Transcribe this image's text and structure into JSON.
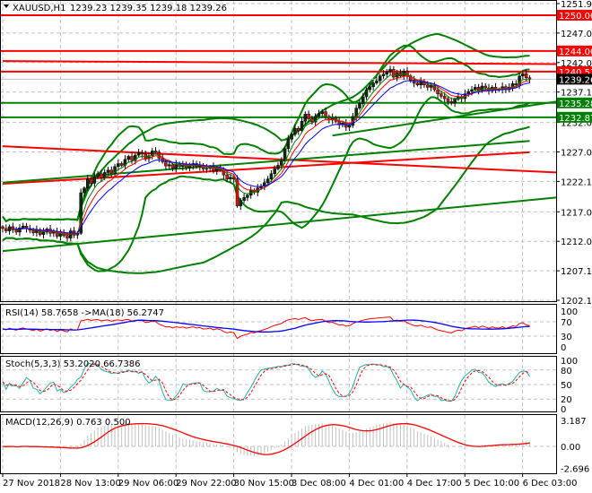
{
  "header": {
    "symbol": "XAUUSD,H1",
    "ohlc": "1239.23 1239.35 1239.18 1239.26"
  },
  "chart_data": [
    {
      "type": "candlestick",
      "panel": "main",
      "symbol": "XAUUSD",
      "timeframe": "H1",
      "ylim": [
        1202.15,
        1251.95
      ],
      "y_ticks": [
        "1251.95",
        "1247.00",
        "1242.05",
        "1237.10",
        "1232.00",
        "1227.05",
        "1222.10",
        "1217.00",
        "1212.05",
        "1207.10",
        "1202.15"
      ],
      "x_ticks": [
        "27 Nov 2018",
        "28 Nov 13:00",
        "29 Nov 06:00",
        "29 Nov 22:00",
        "30 Nov 15:00",
        "3 Dec 08:00",
        "4 Dec 01:00",
        "4 Dec 17:00",
        "5 Dec 10:00",
        "6 Dec 03:00"
      ],
      "grid": true,
      "current_price": "1239.26",
      "closes": [
        1214.2,
        1213.8,
        1214.5,
        1214.0,
        1213.6,
        1214.3,
        1214.6,
        1214.2,
        1213.9,
        1213.5,
        1214.0,
        1213.2,
        1213.6,
        1214.1,
        1213.4,
        1213.7,
        1212.9,
        1213.5,
        1213.0,
        1212.6,
        1213.8,
        1213.1,
        1213.4,
        1220.2,
        1221.0,
        1222.5,
        1221.8,
        1222.9,
        1223.4,
        1222.7,
        1223.6,
        1224.0,
        1223.4,
        1224.6,
        1225.1,
        1224.8,
        1225.8,
        1226.3,
        1225.6,
        1226.5,
        1226.9,
        1226.7,
        1225.9,
        1226.4,
        1227.2,
        1227.0,
        1226.0,
        1225.4,
        1224.7,
        1224.9,
        1224.3,
        1225.0,
        1224.6,
        1224.9,
        1224.4,
        1224.7,
        1225.1,
        1224.6,
        1224.8,
        1224.2,
        1224.3,
        1224.6,
        1223.9,
        1224.3,
        1224.0,
        1223.2,
        1222.5,
        1222.8,
        1222.5,
        1218.0,
        1218.9,
        1219.4,
        1219.8,
        1220.6,
        1220.3,
        1221.0,
        1221.3,
        1221.9,
        1222.5,
        1223.4,
        1224.2,
        1224.8,
        1225.5,
        1227.6,
        1229.2,
        1230.0,
        1231.0,
        1230.6,
        1232.2,
        1233.4,
        1232.6,
        1232.1,
        1233.0,
        1233.5,
        1233.8,
        1233.0,
        1232.4,
        1232.8,
        1232.2,
        1231.6,
        1231.9,
        1231.2,
        1231.5,
        1233.0,
        1234.4,
        1235.2,
        1236.3,
        1237.5,
        1238.0,
        1238.6,
        1239.0,
        1239.8,
        1240.1,
        1240.5,
        1240.9,
        1239.6,
        1240.3,
        1239.8,
        1240.6,
        1239.8,
        1239.1,
        1238.6,
        1238.3,
        1238.9,
        1238.3,
        1237.9,
        1238.2,
        1237.5,
        1236.8,
        1236.4,
        1236.0,
        1235.5,
        1235.3,
        1235.9,
        1236.3,
        1236.0,
        1236.8,
        1237.2,
        1237.5,
        1237.9,
        1237.4,
        1238.1,
        1237.8,
        1237.3,
        1237.9,
        1237.6,
        1237.5,
        1238.0,
        1237.5,
        1237.9,
        1238.5,
        1238.3,
        1239.8,
        1240.2,
        1239.5,
        1239.26
      ],
      "levels": [
        {
          "price": "1250.00",
          "color": "#ff0000"
        },
        {
          "price": "1244.00",
          "color": "#ff0000"
        },
        {
          "price": "1240.53",
          "color": "#ff0000"
        },
        {
          "price": "1235.28",
          "color": "#008000"
        },
        {
          "price": "1232.87",
          "color": "#008000"
        }
      ],
      "trendlines": [
        {
          "color": "#ff0000",
          "from": {
            "bar": 0,
            "price": 1242.3
          },
          "to": {
            "bar": 163,
            "price": 1241.8
          }
        },
        {
          "color": "#ff0000",
          "from": {
            "bar": 0,
            "price": 1228.0
          },
          "to": {
            "bar": 163,
            "price": 1223.6
          }
        },
        {
          "color": "#ff0000",
          "from": {
            "bar": 0,
            "price": 1221.7
          },
          "to": {
            "bar": 155,
            "price": 1227.0
          }
        },
        {
          "color": "#008000",
          "from": {
            "bar": 0,
            "price": 1221.9
          },
          "to": {
            "bar": 155,
            "price": 1228.9
          }
        },
        {
          "color": "#008000",
          "from": {
            "bar": 0,
            "price": 1210.4
          },
          "to": {
            "bar": 163,
            "price": 1219.4
          }
        },
        {
          "color": "#008000",
          "from": {
            "bar": 97,
            "price": 1229.8
          },
          "to": {
            "bar": 163,
            "price": 1235.5
          }
        }
      ],
      "moving_averages": [
        {
          "period": 5,
          "color": "#008000"
        },
        {
          "period": 8,
          "color": "#ff0000"
        },
        {
          "period": 13,
          "color": "#0000ff"
        }
      ],
      "bollinger": [
        {
          "period": 20,
          "deviation": 2,
          "color": "#008000"
        },
        {
          "period": 60,
          "deviation": 2,
          "color": "#008000"
        }
      ],
      "colors": {
        "bull": "#0b2e0b",
        "bear": "#e01010",
        "current_price_label": "#000000"
      }
    },
    {
      "type": "line",
      "panel": "rsi",
      "label": "RSI(14) 58.7658  ->MA(18) 56.2747",
      "ylim": [
        0,
        100
      ],
      "y_ticks": [
        "100",
        "70",
        "30",
        "0"
      ],
      "series": [
        {
          "name": "RSI(14)",
          "color": "#ff0000"
        },
        {
          "name": "MA(18)",
          "color": "#0000ff"
        }
      ]
    },
    {
      "type": "line",
      "panel": "stochastic",
      "label": "Stoch(5,3,3) 53.2020 66.7386",
      "ylim": [
        0,
        100
      ],
      "y_ticks": [
        "100",
        "80",
        "50",
        "20",
        "0"
      ],
      "series": [
        {
          "name": "main",
          "color": "#20b2aa"
        },
        {
          "name": "signal",
          "color": "#ff0000"
        }
      ]
    },
    {
      "type": "bar",
      "panel": "macd",
      "label": "MACD(12,26,9) 0.763 0.500",
      "ylim": [
        -2.696,
        3.187
      ],
      "y_ticks": [
        "3.187",
        "0.00",
        "-2.696"
      ],
      "series": [
        {
          "name": "MACD",
          "color": "#c0c0c0"
        },
        {
          "name": "signal",
          "color": "#ff0000"
        }
      ]
    }
  ]
}
